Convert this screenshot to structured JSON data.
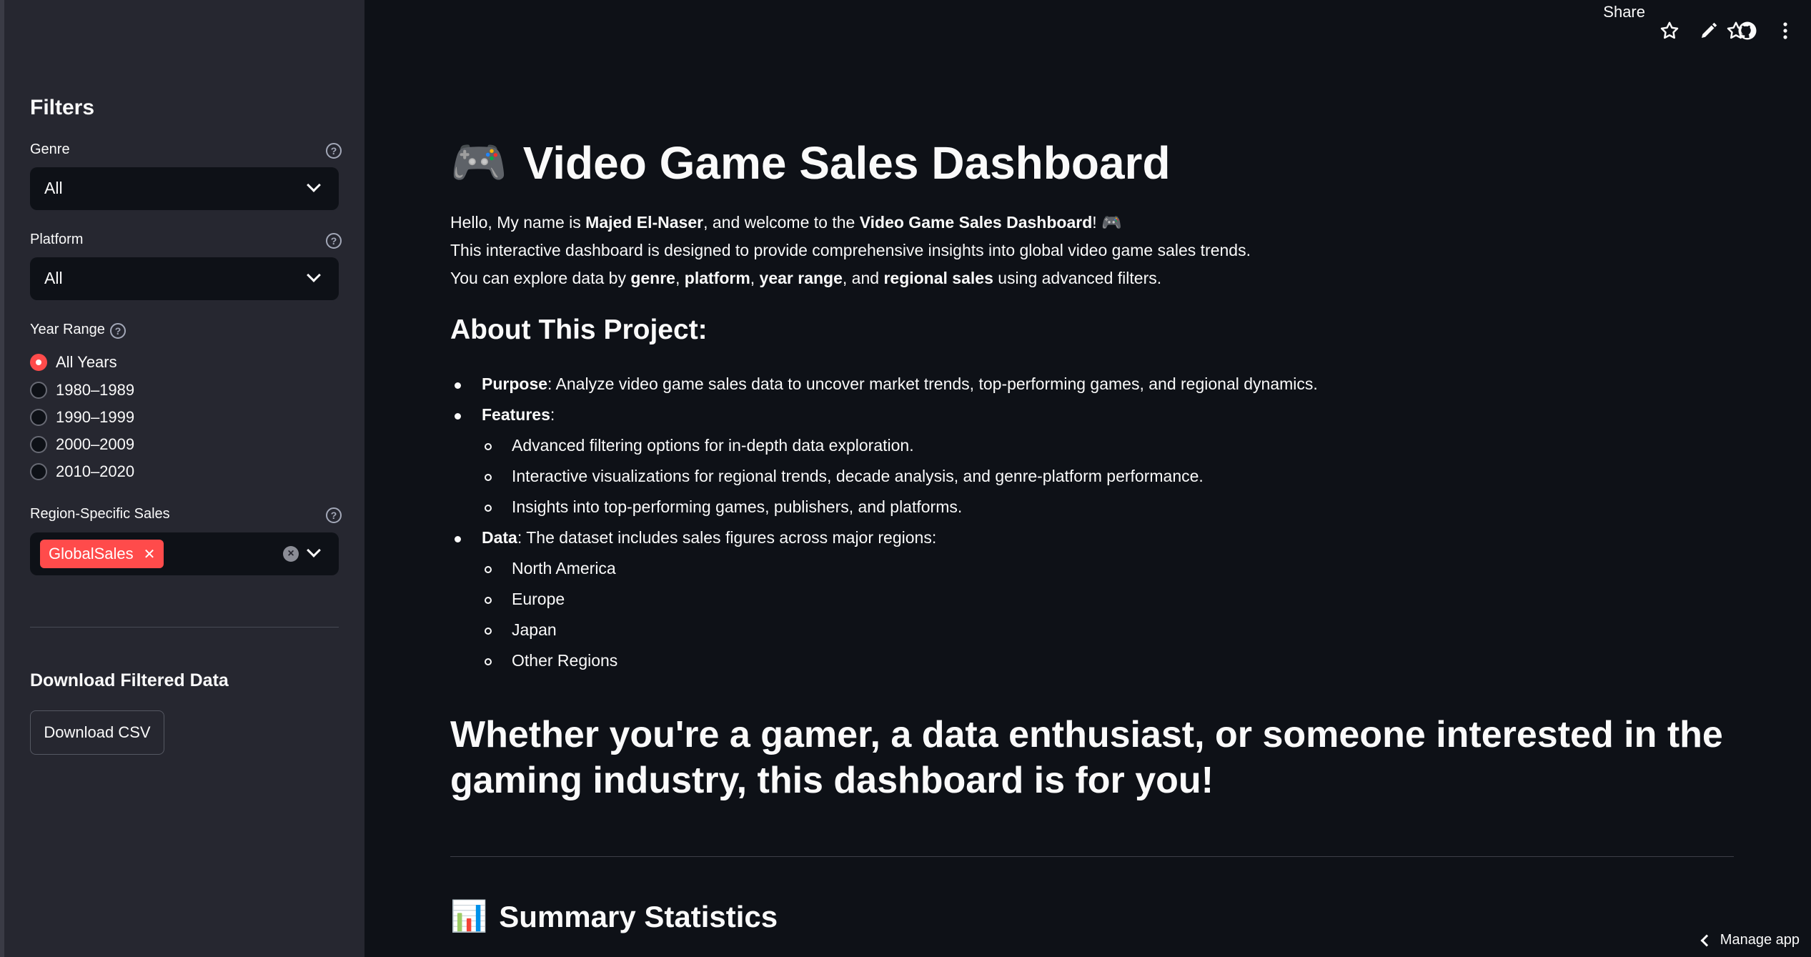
{
  "topbar": {
    "share_label": "Share"
  },
  "sidebar": {
    "title": "Filters",
    "genre": {
      "label": "Genre",
      "value": "All"
    },
    "platform": {
      "label": "Platform",
      "value": "All"
    },
    "year_range": {
      "label": "Year Range",
      "options": [
        "All Years",
        "1980–1989",
        "1990–1999",
        "2000–2009",
        "2010–2020"
      ],
      "selected": "All Years"
    },
    "region": {
      "label": "Region-Specific Sales",
      "chip": "GlobalSales"
    },
    "download": {
      "title": "Download Filtered Data",
      "button": "Download CSV"
    }
  },
  "main": {
    "title_emoji": "🎮",
    "title": "Video Game Sales Dashboard",
    "intro": {
      "line1_pre": "Hello, My name is ",
      "line1_name": "Majed El-Naser",
      "line1_mid": ", and welcome to the ",
      "line1_app": "Video Game Sales Dashboard",
      "line1_post": "! 🎮",
      "line2": "This interactive dashboard is designed to provide comprehensive insights into global video game sales trends.",
      "line3_pre": "You can explore data by ",
      "line3_genre": "genre",
      "line3_sep1": ", ",
      "line3_platform": "platform",
      "line3_sep2": ", ",
      "line3_year": "year range",
      "line3_sep3": ", and ",
      "line3_region": "regional sales",
      "line3_post": " using advanced filters."
    },
    "about_heading": "About This Project:",
    "purpose_label": "Purpose",
    "purpose_text": ": Analyze video game sales data to uncover market trends, top-performing games, and regional dynamics.",
    "features_label": "Features",
    "features_colon": ":",
    "features": [
      "Advanced filtering options for in-depth data exploration.",
      "Interactive visualizations for regional trends, decade analysis, and genre-platform performance.",
      "Insights into top-performing games, publishers, and platforms."
    ],
    "data_label": "Data",
    "data_text": ": The dataset includes sales figures across major regions:",
    "regions": [
      "North America",
      "Europe",
      "Japan",
      "Other Regions"
    ],
    "big_statement": "Whether you're a gamer, a data enthusiast, or someone interested in the gaming industry, this dashboard is for you!",
    "summary_emoji": "📊",
    "summary_heading": "Summary Statistics"
  },
  "footer": {
    "manage_label": "Manage app"
  }
}
